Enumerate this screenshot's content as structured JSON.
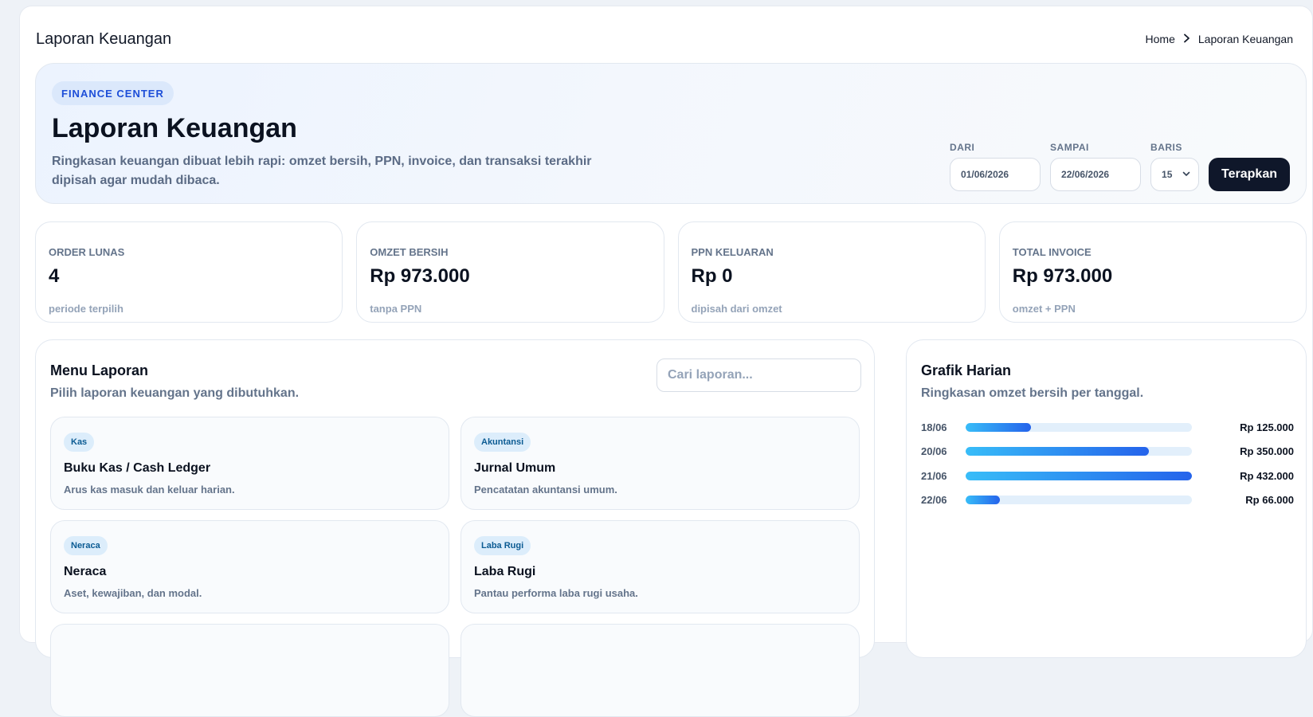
{
  "header": {
    "title": "Laporan Keuangan",
    "breadcrumb": {
      "home": "Home",
      "current": "Laporan Keuangan"
    }
  },
  "hero": {
    "badge": "FINANCE CENTER",
    "title": "Laporan Keuangan",
    "description": "Ringkasan keuangan dibuat lebih rapi: omzet bersih, PPN, invoice, dan transaksi terakhir dipisah agar mudah dibaca."
  },
  "filters": {
    "from": {
      "label": "DARI",
      "value": "01/06/2026"
    },
    "to": {
      "label": "SAMPAI",
      "value": "22/06/2026"
    },
    "rows": {
      "label": "BARIS",
      "value": "15"
    },
    "apply_label": "Terapkan"
  },
  "stats": [
    {
      "label": "ORDER LUNAS",
      "value": "4",
      "note": "periode terpilih"
    },
    {
      "label": "OMZET BERSIH",
      "value": "Rp 973.000",
      "note": "tanpa PPN"
    },
    {
      "label": "PPN KELUARAN",
      "value": "Rp 0",
      "note": "dipisah dari omzet"
    },
    {
      "label": "TOTAL INVOICE",
      "value": "Rp 973.000",
      "note": "omzet + PPN"
    }
  ],
  "menu": {
    "title": "Menu Laporan",
    "subtitle": "Pilih laporan keuangan yang dibutuhkan.",
    "search_placeholder": "Cari laporan...",
    "items": [
      {
        "tag": "Kas",
        "title": "Buku Kas / Cash Ledger",
        "desc": "Arus kas masuk dan keluar harian."
      },
      {
        "tag": "Akuntansi",
        "title": "Jurnal Umum",
        "desc": "Pencatatan akuntansi umum."
      },
      {
        "tag": "Neraca",
        "title": "Neraca",
        "desc": "Aset, kewajiban, dan modal."
      },
      {
        "tag": "Laba Rugi",
        "title": "Laba Rugi",
        "desc": "Pantau performa laba rugi usaha."
      }
    ]
  },
  "chart": {
    "title": "Grafik Harian",
    "subtitle": "Ringkasan omzet bersih per tanggal.",
    "rows": [
      {
        "date": "18/06",
        "amount": 125000,
        "amount_label": "Rp 125.000"
      },
      {
        "date": "20/06",
        "amount": 350000,
        "amount_label": "Rp 350.000"
      },
      {
        "date": "21/06",
        "amount": 432000,
        "amount_label": "Rp 432.000"
      },
      {
        "date": "22/06",
        "amount": 66000,
        "amount_label": "Rp 66.000"
      }
    ]
  },
  "colors": {
    "accent": "#1d4ed8",
    "primary_button": "#0f172a",
    "bar_start": "#38bdf8",
    "bar_end": "#2563eb"
  }
}
